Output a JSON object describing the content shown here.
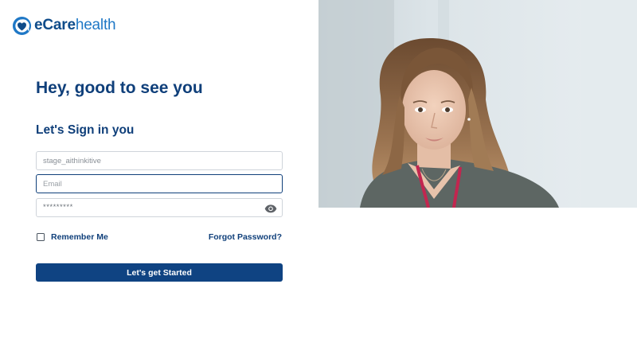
{
  "brand": {
    "name_part1": "eCare",
    "name_part2": "health",
    "icon": "heart-chat-logo-icon",
    "primary_color": "#0f4c8a",
    "accent_color": "#1f78c6"
  },
  "login": {
    "greeting": "Hey, good to see you",
    "subheading": "Let's Sign in you",
    "username": {
      "value": "stage_aithinkitive",
      "placeholder": ""
    },
    "email": {
      "value": "",
      "placeholder": "Email"
    },
    "password": {
      "masked_value": "*********",
      "toggle_icon": "eye-icon"
    },
    "remember_label": "Remember Me",
    "remember_checked": false,
    "forgot_label": "Forgot Password?",
    "submit_label": "Let's get Started",
    "button_color": "#0f4382"
  },
  "hero": {
    "image_subject": "photo of a healthcare professional wearing scrubs with a stethoscope"
  }
}
